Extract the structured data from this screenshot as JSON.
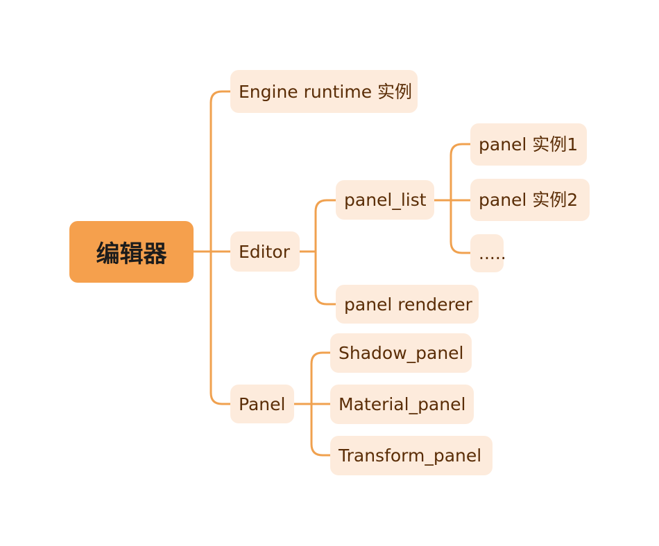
{
  "mindmap": {
    "root": "编辑器",
    "level1": {
      "engine_runtime": "Engine runtime 实例",
      "editor": "Editor",
      "panel": "Panel"
    },
    "editor_children": {
      "panel_list": "panel_list",
      "panel_renderer": "panel renderer"
    },
    "panel_list_children": {
      "instance1": "panel 实例1",
      "instance2": "panel 实例2",
      "more": "....."
    },
    "panel_children": {
      "shadow": "Shadow_panel",
      "material": "Material_panel",
      "transform": "Transform_panel"
    }
  },
  "colors": {
    "connector": "#f0a14f",
    "root_fill": "#f5a04d",
    "node_fill": "#fdebdc",
    "node_text": "#5a2d06"
  }
}
